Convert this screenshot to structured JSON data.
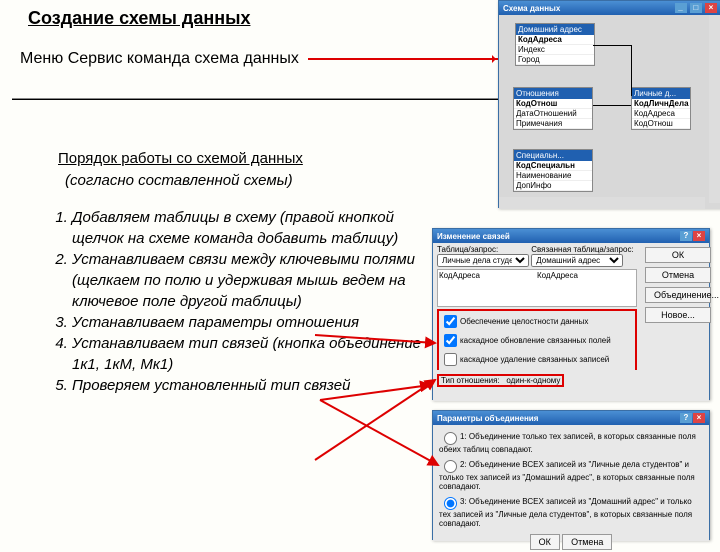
{
  "title": "Создание схемы данных",
  "subtitle": "Меню Сервис команда схема данных",
  "subhead": "Порядок работы со схемой данных",
  "subhead2": "(согласно составленной схемы)",
  "list": [
    "Добавляем таблицы в схему (правой кнопкой щелчок на схеме команда добавить таблицу)",
    "Устанавливаем связи между ключевыми полями (щелкаем по полю и удерживая мышь ведем на ключевое поле другой таблицы)",
    "Устанавливаем параметры отношения",
    "Устанавливаем тип связей (кнопка объединение 1к1, 1кМ, Мк1)",
    "Проверяем установленный тип связей"
  ],
  "schema_win": {
    "title": "Схема данных",
    "minimize": "_",
    "maximize": "□",
    "close": "×",
    "t1": {
      "caption": "Домашний адрес",
      "fields": [
        "КодАдреса",
        "Индекс",
        "Город"
      ]
    },
    "t2": {
      "caption": "Отношения",
      "fields": [
        "КодОтнош",
        "ДатаОтношений",
        "Примечания"
      ]
    },
    "t3": {
      "caption": "Личные д...",
      "fields": [
        "КодЛичнДела",
        "КодАдреса",
        "КодОтнош"
      ]
    },
    "t4": {
      "caption": "Специальн...",
      "fields": [
        "КодСпециальн",
        "Наименование",
        "ДопИнфо"
      ]
    }
  },
  "rel_win": {
    "title": "Изменение связей",
    "label1": "Таблица/запрос:",
    "label2": "Связанная таблица/запрос:",
    "combo1": "Личные дела студен",
    "combo2": "Домашний адрес",
    "field1": "КодАдреса",
    "field2": "КодАдреса",
    "ok": "ОК",
    "cancel": "Отмена",
    "join": "Объединение...",
    "new": "Новое...",
    "chk1": "Обеспечение целостности данных",
    "chk2": "каскадное обновление связанных полей",
    "chk3": "каскадное удаление связанных записей",
    "reltype_lbl": "Тип отношения:",
    "reltype": "один-к-одному"
  },
  "join_win": {
    "title": "Параметры объединения",
    "help": "?",
    "close": "×",
    "opt1": "Объединение только тех записей, в которых связанные поля обеих таблиц совпадают.",
    "opt2": "Объединение ВСЕХ записей из \"Личные дела студентов\" и только тех записей из \"Домашний адрес\", в которых связанные поля совпадают.",
    "opt3": "Объединение ВСЕХ записей из \"Домашний адрес\" и только тех записей из \"Личные дела студентов\", в которых связанные поля совпадают.",
    "ok": "ОК",
    "cancel": "Отмена"
  }
}
